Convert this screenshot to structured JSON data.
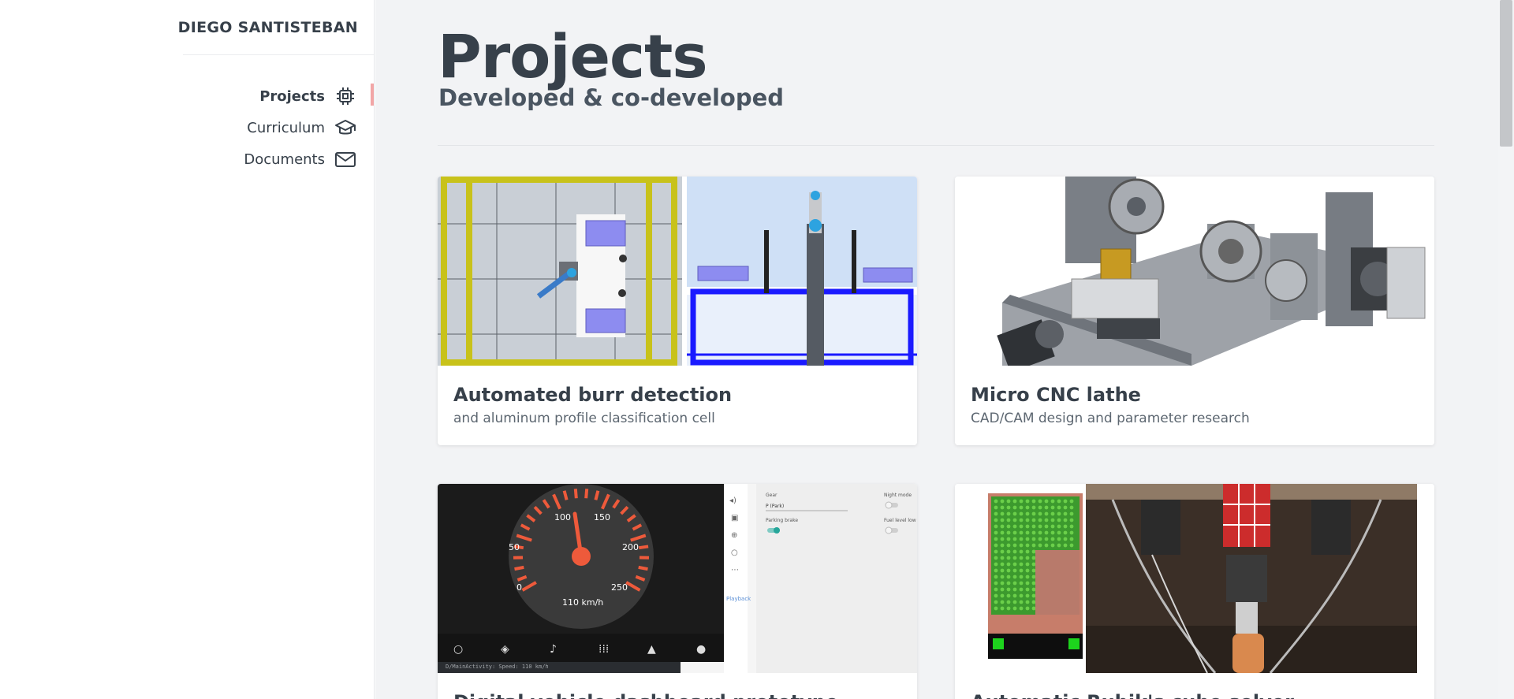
{
  "brand": "DIEGO SANTISTEBAN",
  "nav": {
    "items": [
      {
        "label": "Projects",
        "icon": "chip-icon",
        "active": true
      },
      {
        "label": "Curriculum",
        "icon": "graduation-cap-icon",
        "active": false
      },
      {
        "label": "Documents",
        "icon": "mail-icon",
        "active": false
      }
    ]
  },
  "page": {
    "title": "Projects",
    "subtitle": "Developed & co-developed"
  },
  "cards": [
    {
      "title": "Automated burr detection",
      "subtitle": "and aluminum profile classification cell"
    },
    {
      "title": "Micro CNC lathe",
      "subtitle": "CAD/CAM design and parameter research"
    },
    {
      "title": "Digital vehicle dashboard prototype",
      "subtitle": ""
    },
    {
      "title": "Automatic Rubik's cube solver",
      "subtitle": ""
    }
  ],
  "dashboard": {
    "ticks": [
      "0",
      "50",
      "100",
      "150",
      "200",
      "250"
    ],
    "speed_text": "110 km/h",
    "gear_label": "Gear",
    "gear_value": "P (Park)",
    "night_mode_label": "Night mode",
    "parking_brake_label": "Parking brake",
    "fuel_label": "Fuel level low",
    "playback_label": "Playback",
    "log_line_1": "D/MainActivity: Speed: 110 km/h",
    "log_line_2": "D/MainActivity: Speed: 110 km/h"
  },
  "colors": {
    "accent": "#f2a6a6",
    "text": "#37404a",
    "background": "#f2f3f5"
  }
}
